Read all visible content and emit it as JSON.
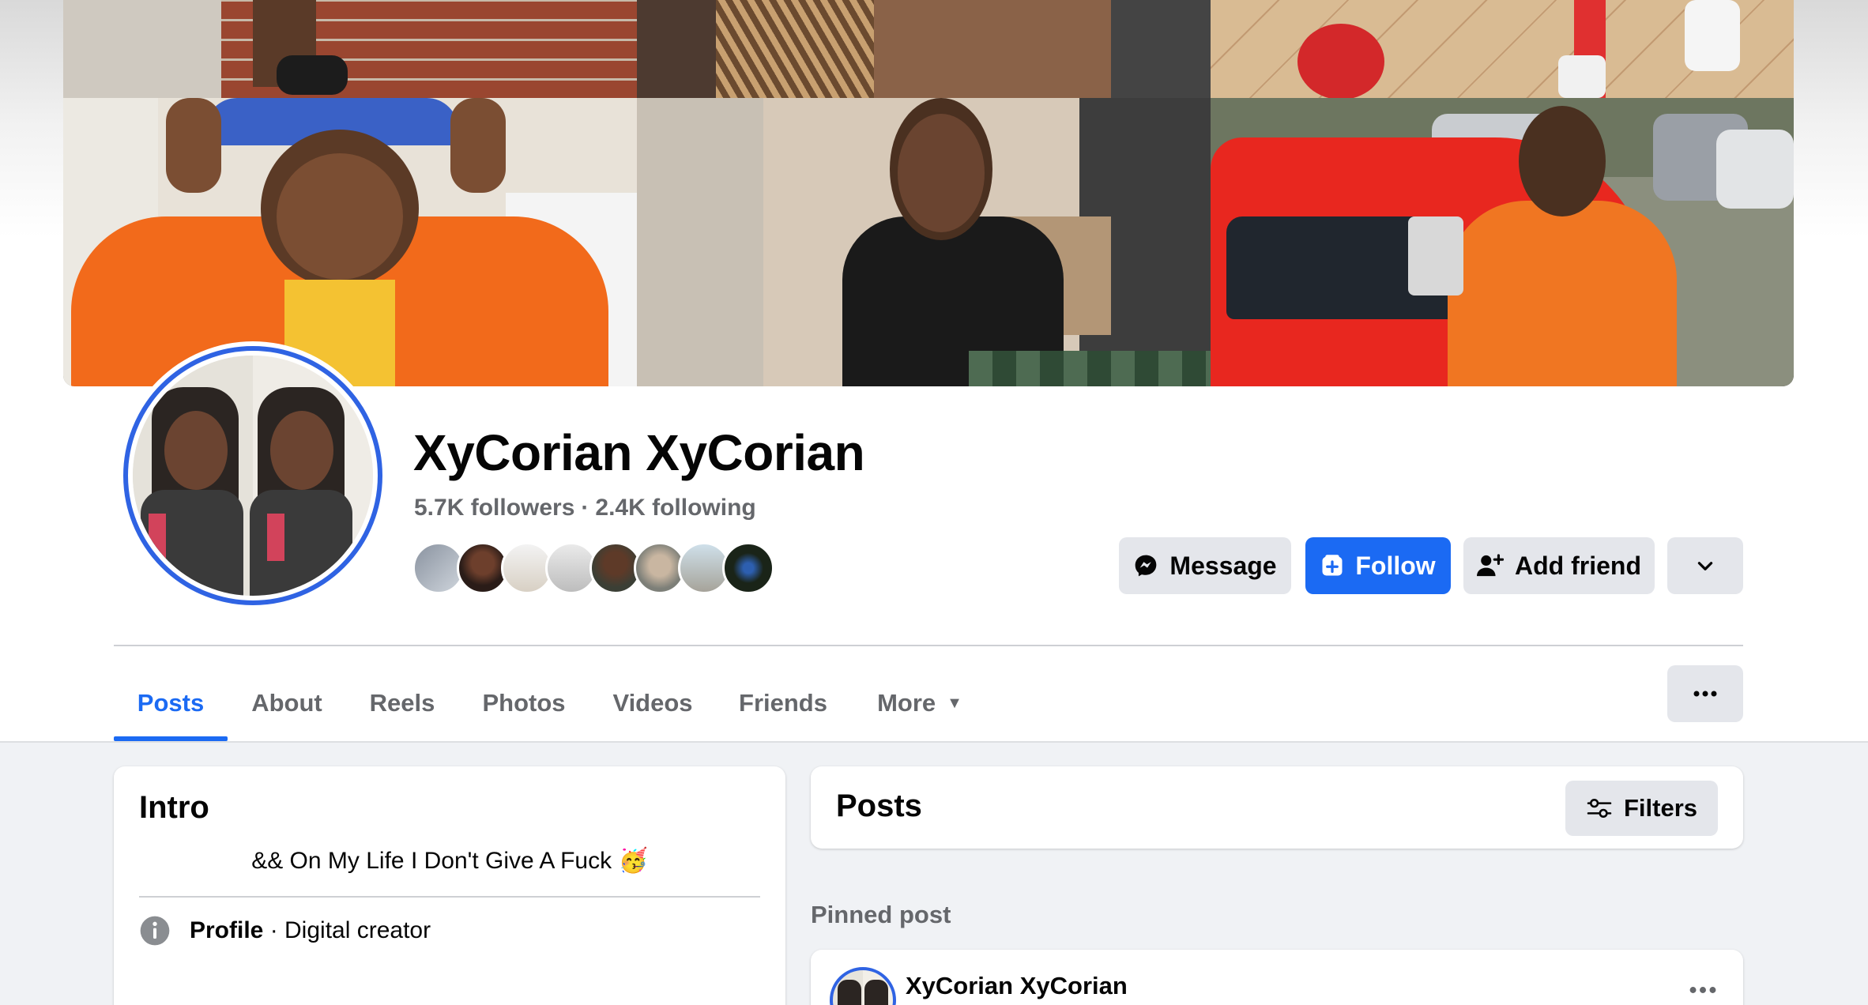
{
  "profile": {
    "name": "XyCorian XyCorian",
    "followers": "5.7K followers",
    "following": "2.4K following",
    "separator": "·"
  },
  "actions": {
    "message": "Message",
    "follow": "Follow",
    "add_friend": "Add friend"
  },
  "tabs": [
    {
      "label": "Posts",
      "active": true
    },
    {
      "label": "About"
    },
    {
      "label": "Reels"
    },
    {
      "label": "Photos"
    },
    {
      "label": "Videos"
    },
    {
      "label": "Friends"
    },
    {
      "label": "More"
    }
  ],
  "intro": {
    "title": "Intro",
    "bio": "&& On My Life I Don't Give A Fuck 🥳",
    "profile_label": "Profile",
    "profile_detail": " · Digital creator"
  },
  "posts": {
    "title": "Posts",
    "filters": "Filters",
    "pinned_label": "Pinned post",
    "pinned_author": "XyCorian XyCorian"
  },
  "colors": {
    "accent": "#1b6af3",
    "avatar_ring": "#2f63e3",
    "secondary_text": "#65676b",
    "button_grey": "#e4e6eb"
  }
}
